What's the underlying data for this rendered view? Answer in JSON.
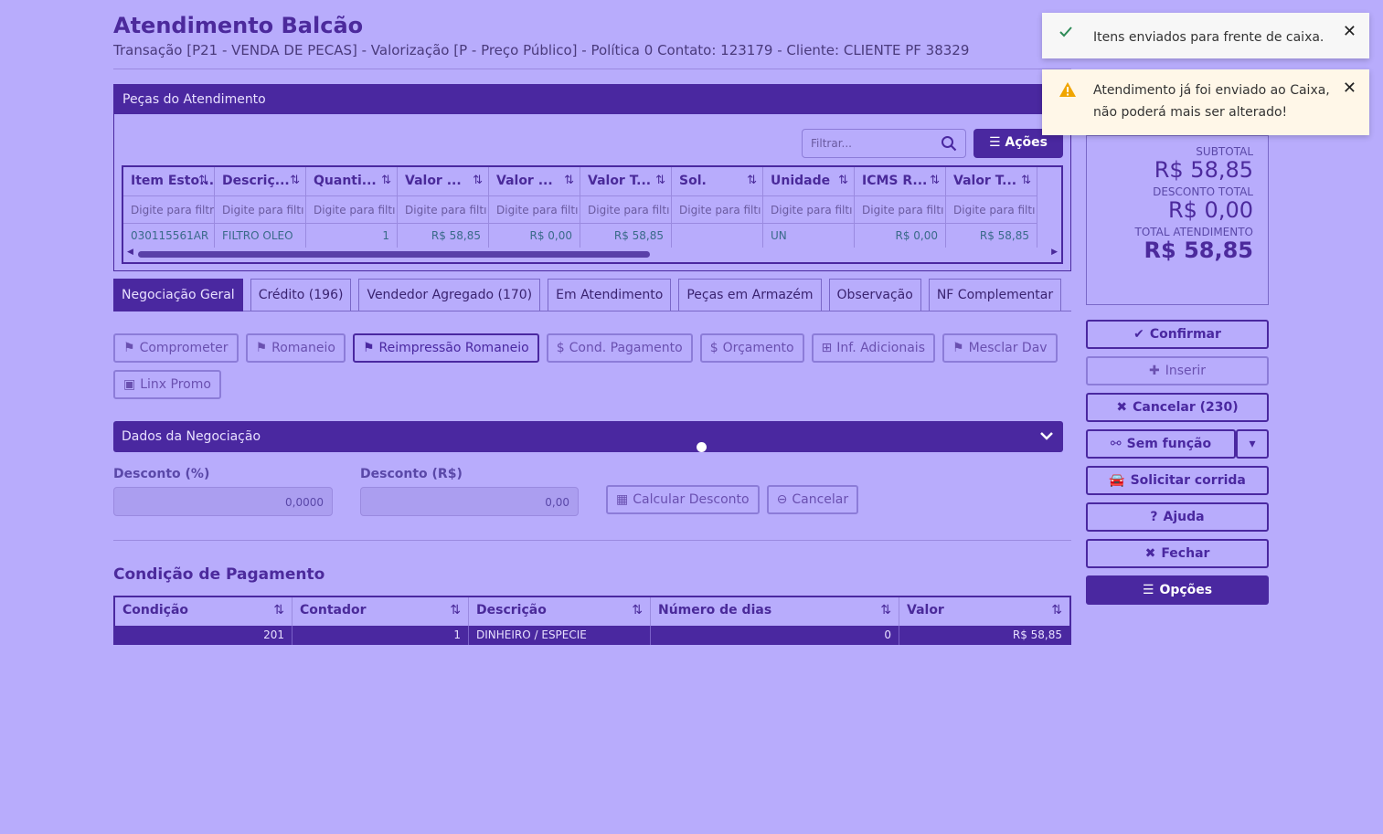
{
  "header": {
    "title": "Atendimento Balcão",
    "subtitle": "Transação [P21 - VENDA DE PECAS] - Valorização [P - Preço Público] - Política 0 Contato: 123179 - Cliente: CLIENTE PF 38329"
  },
  "parts_panel": {
    "title": "Peças do Atendimento",
    "filter_placeholder": "Filtrar...",
    "actions_label": "Ações",
    "columns": [
      "Item Esto...",
      "Descriç...",
      "Quanti...",
      "Valor ...",
      "Valor ...",
      "Valor T...",
      "Sol.",
      "Unidade",
      "ICMS R...",
      "Valor T..."
    ],
    "filter_placeholders": [
      "Digite para filtrar...",
      "Digite para filtı",
      "Digite para filtı",
      "Digite para filtı",
      "Digite para filtı",
      "Digite para filtı",
      "Digite para filtı",
      "Digite para filtı",
      "Digite para filtı",
      "Digite para filtı"
    ],
    "row": [
      "030115561AR",
      "FILTRO OLEO",
      "1",
      "R$ 58,85",
      "R$ 0,00",
      "R$ 58,85",
      "",
      "UN",
      "R$ 0,00",
      "R$ 58,85"
    ]
  },
  "tabs": [
    "Negociação Geral",
    "Crédito (196)",
    "Vendedor Agregado (170)",
    "Em Atendimento",
    "Peças em Armazém",
    "Observação",
    "NF Complementar"
  ],
  "action_buttons": {
    "comprometer": "Comprometer",
    "romaneio": "Romaneio",
    "reimpressao": "Reimpressão Romaneio",
    "cond_pagamento": "Cond. Pagamento",
    "orcamento": "Orçamento",
    "inf_adicionais": "Inf. Adicionais",
    "mesclar": "Mesclar Dav",
    "linx_promo": "Linx Promo"
  },
  "negotiation": {
    "section_title": "Dados da Negociação",
    "discount_pct_label": "Desconto (%)",
    "discount_pct_value": "0,0000",
    "discount_brl_label": "Desconto (R$)",
    "discount_brl_value": "0,00",
    "calc_button": "Calcular Desconto",
    "cancel_button": "Cancelar"
  },
  "payment": {
    "title": "Condição de Pagamento",
    "columns": [
      "Condição",
      "Contador",
      "Descrição",
      "Número de dias",
      "Valor"
    ],
    "row": [
      "201",
      "1",
      "DINHEIRO / ESPECIE",
      "0",
      "R$ 58,85"
    ]
  },
  "summary": {
    "subtotal_label": "SUBTOTAL",
    "subtotal_value": "R$ 58,85",
    "discount_label": "DESCONTO TOTAL",
    "discount_value": "R$ 0,00",
    "total_label": "TOTAL ATENDIMENTO",
    "total_value": "R$ 58,85"
  },
  "side_buttons": {
    "confirmar": "Confirmar",
    "inserir": "Inserir",
    "cancelar": "Cancelar (230)",
    "sem_funcao": "Sem função",
    "solicitar": "Solicitar corrida",
    "ajuda": "Ajuda",
    "fechar": "Fechar",
    "opcoes": "Opções"
  },
  "toasts": {
    "success": "Itens enviados para frente de caixa.",
    "warning": "Atendimento já foi enviado ao Caixa, não poderá mais ser alterado!"
  },
  "colors": {
    "primary": "#4a28a0",
    "background": "#b8acfc",
    "success": "#2e8b57",
    "warning": "#f0a500"
  }
}
